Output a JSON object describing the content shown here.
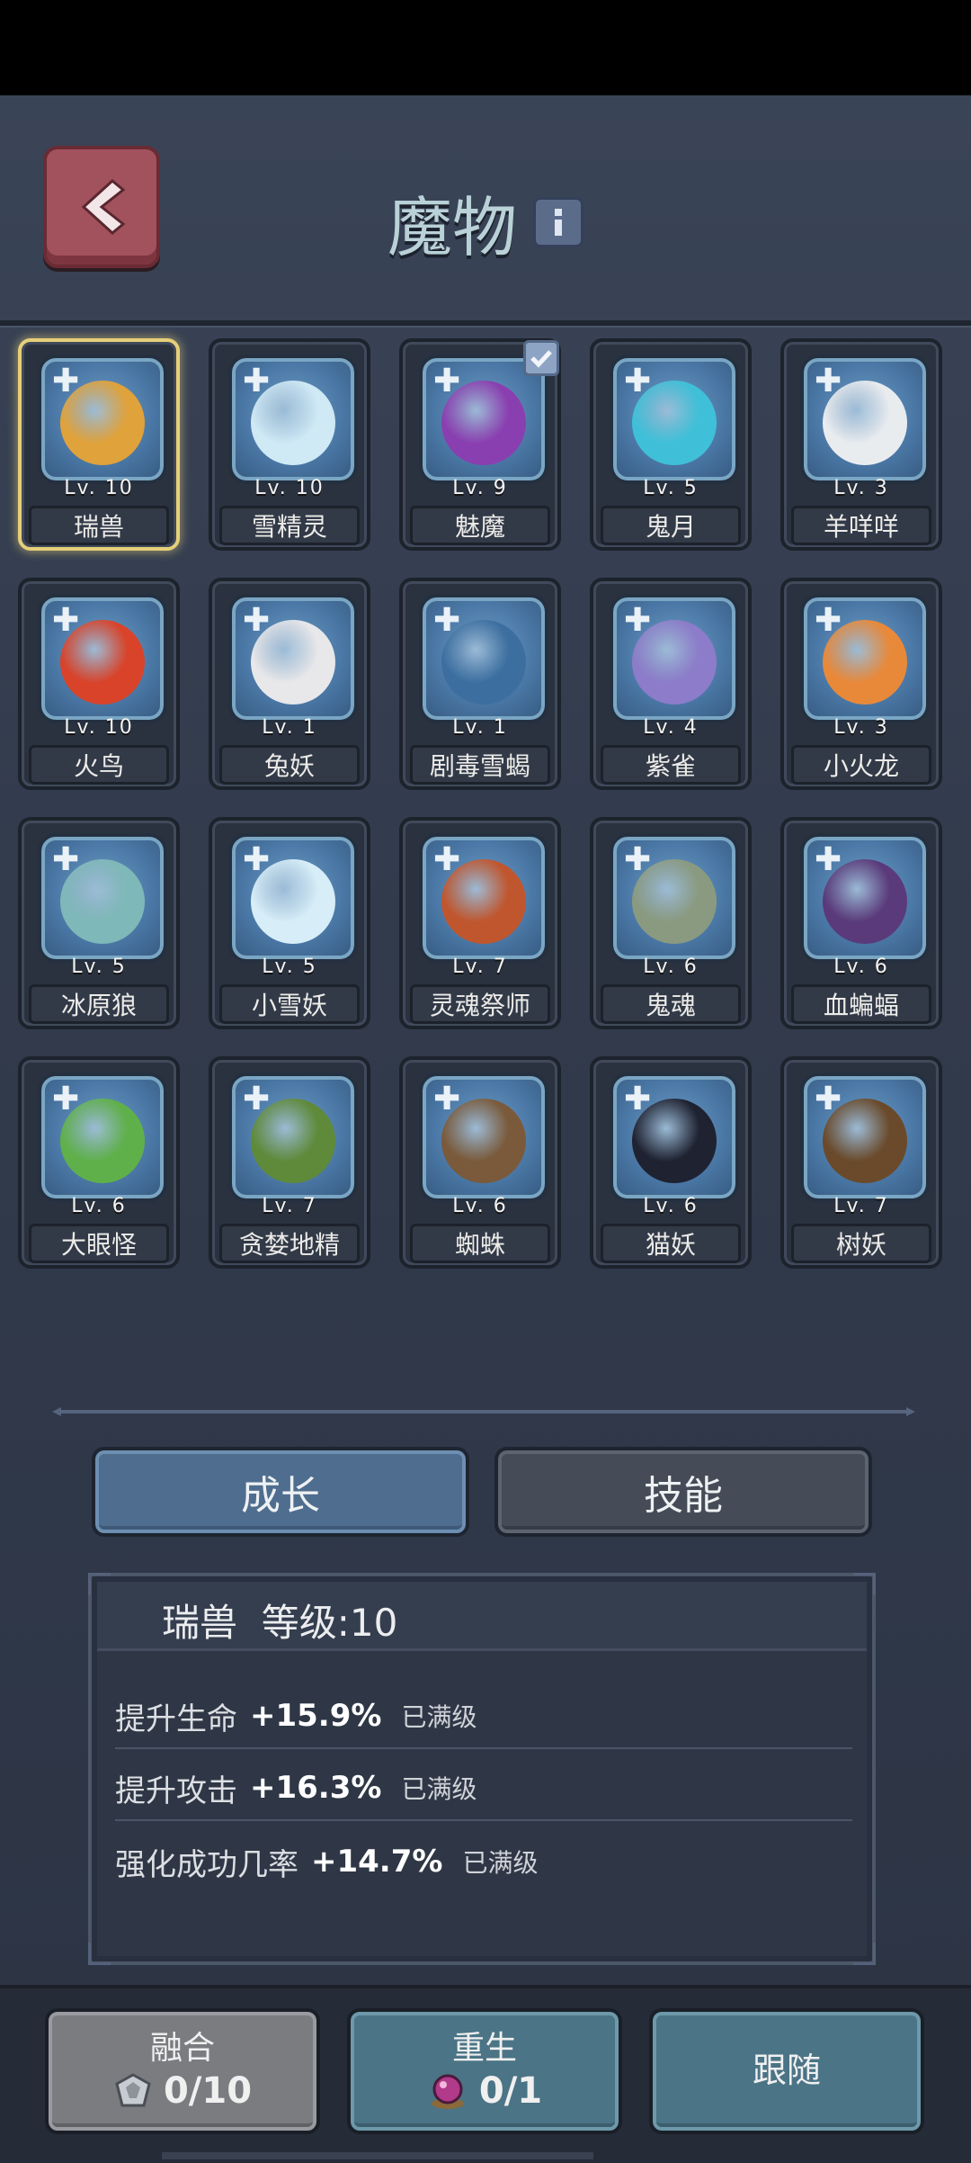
{
  "header": {
    "title": "魔物"
  },
  "monsters": [
    {
      "name": "瑞兽",
      "level": "Lv. 10",
      "color": "#e0a23a",
      "selected": true
    },
    {
      "name": "雪精灵",
      "level": "Lv. 10",
      "color": "#cfe9f5"
    },
    {
      "name": "魅魔",
      "level": "Lv. 9",
      "color": "#8a3fb0",
      "checked": true
    },
    {
      "name": "鬼月",
      "level": "Lv. 5",
      "color": "#3fc0d8"
    },
    {
      "name": "羊咩咩",
      "level": "Lv. 3",
      "color": "#e9ecef"
    },
    {
      "name": "火鸟",
      "level": "Lv. 10",
      "color": "#d8432a"
    },
    {
      "name": "兔妖",
      "level": "Lv. 1",
      "color": "#e8e8ea"
    },
    {
      "name": "剧毒雪蝎",
      "level": "Lv. 1",
      "color": "#3c6fa0"
    },
    {
      "name": "紫雀",
      "level": "Lv. 4",
      "color": "#8c7cc9"
    },
    {
      "name": "小火龙",
      "level": "Lv. 3",
      "color": "#e8893a"
    },
    {
      "name": "冰原狼",
      "level": "Lv. 5",
      "color": "#7fb8b8"
    },
    {
      "name": "小雪妖",
      "level": "Lv. 5",
      "color": "#d7eef8"
    },
    {
      "name": "灵魂祭师",
      "level": "Lv. 7",
      "color": "#c0562e"
    },
    {
      "name": "鬼魂",
      "level": "Lv. 6",
      "color": "#8a9a80"
    },
    {
      "name": "血蝙蝠",
      "level": "Lv. 6",
      "color": "#5a3a7a"
    },
    {
      "name": "大眼怪",
      "level": "Lv. 6",
      "color": "#5fb04a"
    },
    {
      "name": "贪婪地精",
      "level": "Lv. 7",
      "color": "#5f8a3a"
    },
    {
      "name": "蜘蛛",
      "level": "Lv. 6",
      "color": "#7a5a3a"
    },
    {
      "name": "猫妖",
      "level": "Lv. 6",
      "color": "#1f2230"
    },
    {
      "name": "树妖",
      "level": "Lv. 7",
      "color": "#6a4a2a"
    }
  ],
  "tabs": {
    "growth": "成长",
    "skill": "技能"
  },
  "panel": {
    "title": "瑞兽  等级:10",
    "stats": [
      {
        "label": "提升生命",
        "value": "+15.9%",
        "status": "已满级"
      },
      {
        "label": "提升攻击",
        "value": "+16.3%",
        "status": "已满级"
      },
      {
        "label": "强化成功几率",
        "value": "+14.7%",
        "status": "已满级"
      }
    ]
  },
  "bottom": {
    "fuse": {
      "label": "融合",
      "count": "0/10"
    },
    "rebirth": {
      "label": "重生",
      "count": "0/1"
    },
    "follow": {
      "label": "跟随"
    }
  },
  "colors": {
    "selected_border": "#e6cf7a",
    "growth_tab": "#4f6d8f",
    "follow_btn": "#4b7486"
  }
}
